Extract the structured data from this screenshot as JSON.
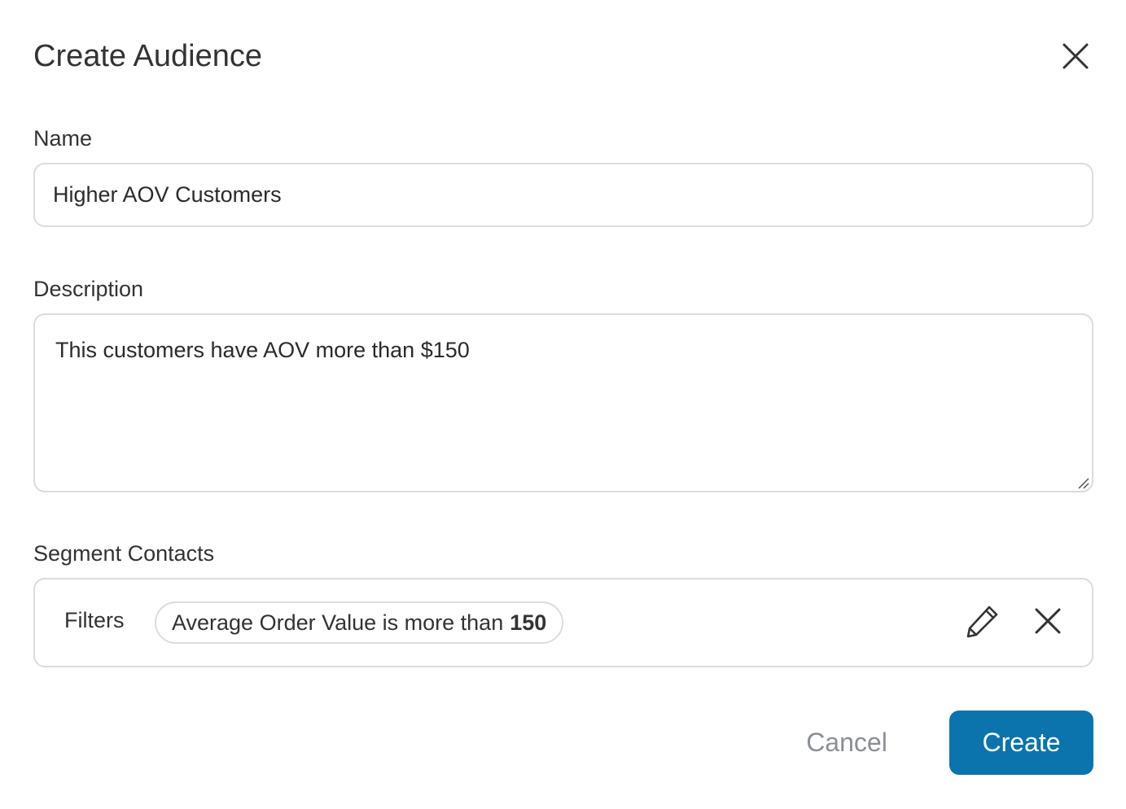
{
  "dialog": {
    "title": "Create Audience"
  },
  "name_field": {
    "label": "Name",
    "value": "Higher AOV Customers"
  },
  "description_field": {
    "label": "Description",
    "value": "This customers have AOV more than $150"
  },
  "segment": {
    "label": "Segment Contacts",
    "filters_label": "Filters",
    "filters": [
      {
        "text": "Average Order Value is more than",
        "value": "150"
      }
    ]
  },
  "actions": {
    "cancel_label": "Cancel",
    "create_label": "Create"
  },
  "icons": {
    "close": "close-icon",
    "edit": "pencil-icon",
    "remove": "close-icon",
    "resize": "resize-handle-icon"
  },
  "colors": {
    "primary": "#0b74ad",
    "cancel_text": "#8a8f98",
    "border": "#dcdcdc"
  }
}
